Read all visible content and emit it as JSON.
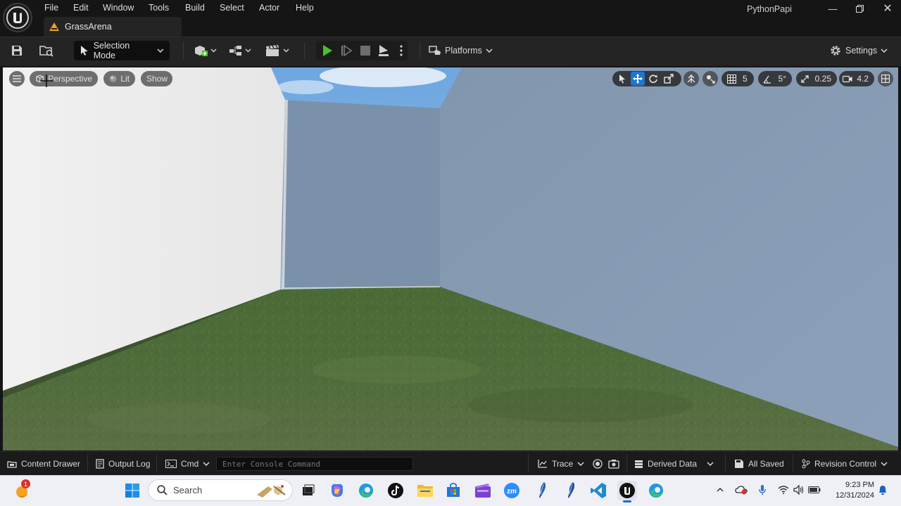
{
  "menu": {
    "items": [
      "File",
      "Edit",
      "Window",
      "Tools",
      "Build",
      "Select",
      "Actor",
      "Help"
    ],
    "level_tab": "GrassArena",
    "project_name": "PythonPapi"
  },
  "toolbar": {
    "selection_mode": "Selection Mode",
    "platforms": "Platforms",
    "settings": "Settings"
  },
  "viewport": {
    "perspective": "Perspective",
    "lit": "Lit",
    "show": "Show",
    "grid_snap": "5",
    "rotation_snap": "5°",
    "scale_snap": "0.25",
    "camera_speed": "4.2"
  },
  "statusbar": {
    "content_drawer": "Content Drawer",
    "output_log": "Output Log",
    "cmd": "Cmd",
    "console_placeholder": "Enter Console Command",
    "trace": "Trace",
    "derived_data": "Derived Data",
    "all_saved": "All Saved",
    "revision_control": "Revision Control"
  },
  "taskbar": {
    "search_placeholder": "Search",
    "weather_badge": "1",
    "time": "9:23 PM",
    "date": "12/31/2024"
  },
  "colors": {
    "accent_blue": "#1a77d4",
    "play_green": "#4cc02e",
    "level_icon_orange": "#f0a020",
    "grass": "#4e6b37",
    "wall": "#8294ad"
  }
}
